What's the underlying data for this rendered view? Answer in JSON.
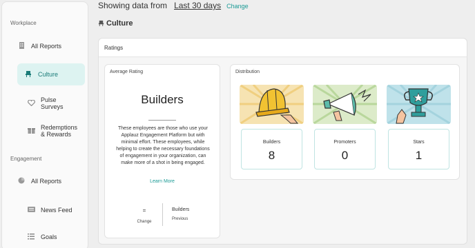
{
  "sidebar": {
    "workplace_label": "Workplace",
    "engagement_label": "Engagement",
    "workplace_items": [
      {
        "label": "All Reports",
        "icon": "building-icon"
      },
      {
        "label": "Culture",
        "icon": "armchair-icon",
        "active": true
      },
      {
        "label": "Pulse Surveys",
        "icon": "heartbeat-icon"
      },
      {
        "label": "Redemptions & Rewards",
        "icon": "gift-box-icon"
      }
    ],
    "engagement_items": [
      {
        "label": "All Reports",
        "icon": "circle-chart-icon"
      },
      {
        "label": "News Feed",
        "icon": "news-icon"
      },
      {
        "label": "Goals",
        "icon": "checklist-icon"
      }
    ]
  },
  "topbar": {
    "prefix": "Showing data from",
    "range": "Last 30 days",
    "change": "Change"
  },
  "page": {
    "title": "Culture"
  },
  "ratings": {
    "heading": "Ratings",
    "average": {
      "label": "Average Rating",
      "value": "Builders",
      "description": "These employees are those who use your Applauz Engagement Platform but with minimal effort. These employees, while helping to create the necessary foundations of engagement in your organization, can make more of a shot in being engaged.",
      "learn_more": "Learn More",
      "change_symbol": "=",
      "change_label": "Change",
      "previous_value": "Builders",
      "previous_label": "Previous"
    },
    "distribution": {
      "label": "Distribution",
      "items": [
        {
          "label": "Builders",
          "value": "8",
          "icon": "hard-hat-icon",
          "bg": "#f6e3b2"
        },
        {
          "label": "Promoters",
          "value": "0",
          "icon": "megaphone-icon",
          "bg": "#dcebc9"
        },
        {
          "label": "Stars",
          "value": "1",
          "icon": "trophy-icon",
          "bg": "#bfe2ea"
        }
      ]
    }
  },
  "colors": {
    "accent": "#1a9a95",
    "active_bg": "#ddf3f1"
  }
}
